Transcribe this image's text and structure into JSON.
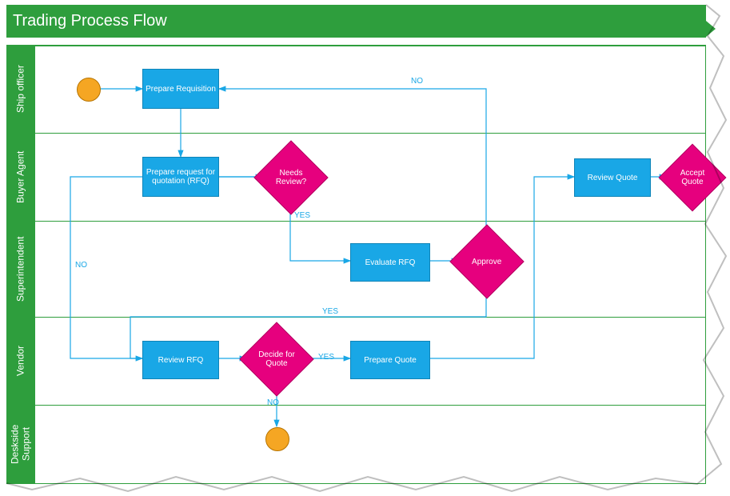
{
  "title": "Trading Process Flow",
  "lanes": [
    {
      "id": "ship-officer",
      "label": "Ship officer"
    },
    {
      "id": "buyer-agent",
      "label": "Buyer Agent"
    },
    {
      "id": "superintendent",
      "label": "Superintendent"
    },
    {
      "id": "vendor",
      "label": "Vendor"
    },
    {
      "id": "deskside",
      "label": "Deskside\nSupport"
    }
  ],
  "nodes": {
    "start": {
      "type": "start"
    },
    "prepare_req": {
      "type": "process",
      "label": "Prepare Requisition"
    },
    "prepare_rfq": {
      "type": "process",
      "label": "Prepare request for quotation (RFQ)"
    },
    "needs_review": {
      "type": "decision",
      "label": "Needs Review?"
    },
    "evaluate_rfq": {
      "type": "process",
      "label": "Evaluate RFQ"
    },
    "approve": {
      "type": "decision",
      "label": "Approve"
    },
    "review_rfq": {
      "type": "process",
      "label": "Review RFQ"
    },
    "decide_quote": {
      "type": "decision",
      "label": "Decide for Quote"
    },
    "prepare_quote": {
      "type": "process",
      "label": "Prepare Quote"
    },
    "review_quote": {
      "type": "process",
      "label": "Review Quote"
    },
    "accept_quote": {
      "type": "decision",
      "label": "Accept Quote"
    },
    "end": {
      "type": "end"
    }
  },
  "edges": {
    "yes": "YES",
    "no": "NO"
  }
}
